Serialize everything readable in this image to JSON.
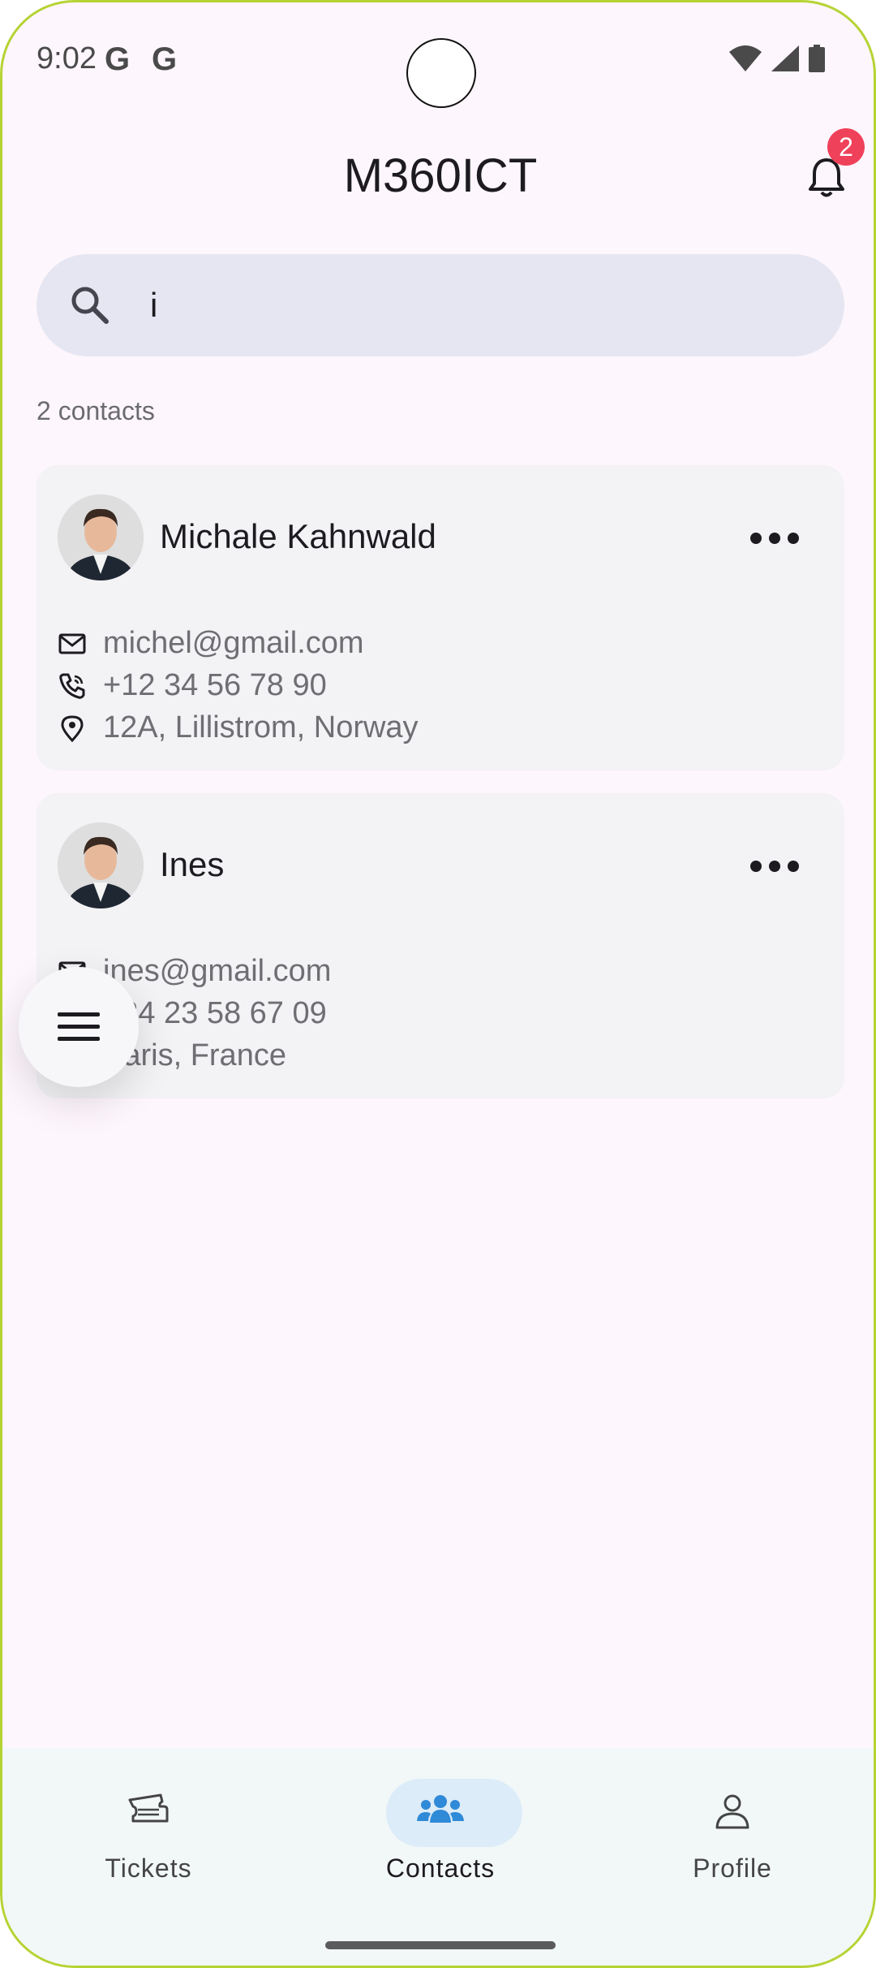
{
  "status_bar": {
    "time": "9:02",
    "g_icons": [
      "G",
      "G"
    ]
  },
  "header": {
    "title": "M360ICT",
    "notification_count": "2"
  },
  "search": {
    "value": "i",
    "placeholder": ""
  },
  "results": {
    "count_label": "2 contacts"
  },
  "contacts": [
    {
      "name": "Michale Kahnwald",
      "email": "michel@gmail.com",
      "phone": "+12 34 56 78 90",
      "address": "12A, Lillistrom, Norway"
    },
    {
      "name": "Ines",
      "email": "ines@gmail.com",
      "phone": "+34 23 58 67 09",
      "address": "Paris, France"
    }
  ],
  "bottom_nav": {
    "items": [
      {
        "label": "Tickets",
        "icon": "ticket-icon",
        "active": false
      },
      {
        "label": "Contacts",
        "icon": "contacts-icon",
        "active": true
      },
      {
        "label": "Profile",
        "icon": "profile-icon",
        "active": false
      }
    ]
  },
  "colors": {
    "background": "#fdf6fc",
    "accent": "#2f8ad8",
    "badge": "#f0415a",
    "active_pill": "#dcecf8"
  }
}
